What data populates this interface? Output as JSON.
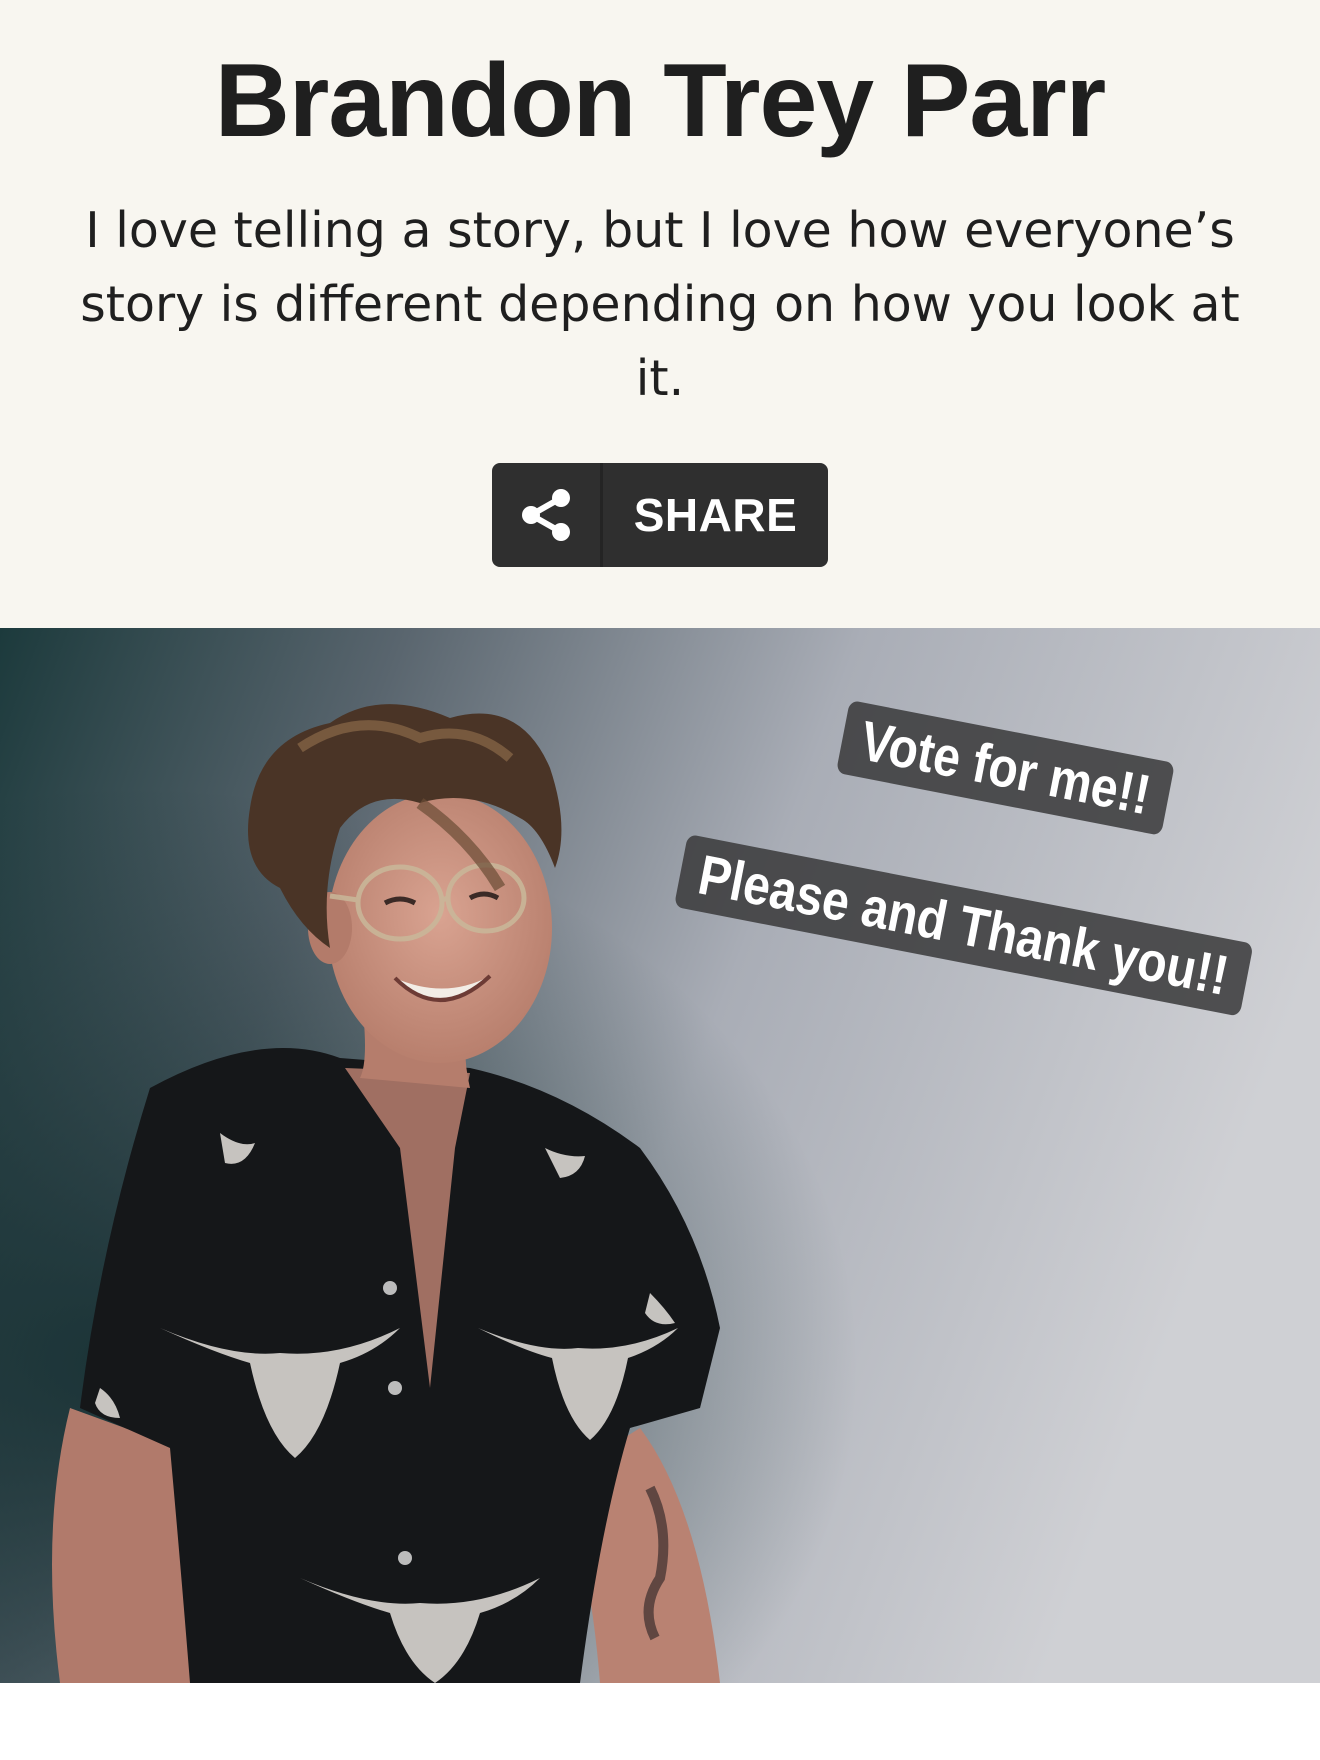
{
  "profile": {
    "name": "Brandon Trey Parr",
    "bio": "I love telling a story, but I love how everyone’s story is different depending on how you look at it."
  },
  "share_button": {
    "label": "SHARE",
    "icon": "share-icon"
  },
  "photo": {
    "stickers": [
      "Vote for me!!",
      "Please and Thank you!!"
    ]
  },
  "colors": {
    "header_background": "#f8f6f0",
    "title_text": "#1f1f1f",
    "share_button_background": "#2f2f2f",
    "sticker_background": "#3c3c3e"
  }
}
